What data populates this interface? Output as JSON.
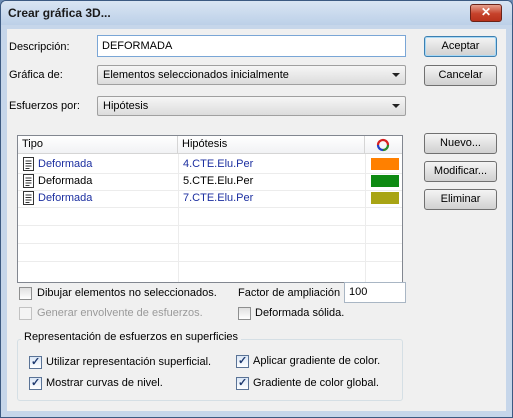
{
  "window": {
    "title": "Crear gráfica 3D...",
    "close_glyph": "✕"
  },
  "form": {
    "descripcion_label": "Descripción:",
    "descripcion_value": "DEFORMADA",
    "grafica_label": "Gráfica de:",
    "grafica_value": "Elementos seleccionados inicialmente",
    "esfuerzos_label": "Esfuerzos por:",
    "esfuerzos_value": "Hipótesis"
  },
  "buttons": {
    "aceptar": "Aceptar",
    "cancelar": "Cancelar",
    "nuevo": "Nuevo...",
    "modificar": "Modificar...",
    "eliminar": "Eliminar"
  },
  "table": {
    "headers": {
      "tipo": "Tipo",
      "hipotesis": "Hipótesis",
      "color_icon": "color-wheel-icon"
    },
    "rows": [
      {
        "tipo": "Deformada",
        "hipotesis": "4.CTE.Elu.Per",
        "color": "#ff8000",
        "highlight": true
      },
      {
        "tipo": "Deformada",
        "hipotesis": "5.CTE.Elu.Per",
        "color": "#0e8a12",
        "highlight": false
      },
      {
        "tipo": "Deformada",
        "hipotesis": "7.CTE.Elu.Per",
        "color": "#a8a414",
        "highlight": true
      }
    ]
  },
  "options": {
    "dibujar_label": "Dibujar elementos no seleccionados.",
    "dibujar_checked": false,
    "envolvente_label": "Generar envolvente de esfuerzos.",
    "envolvente_enabled": false,
    "factor_label": "Factor de ampliación",
    "factor_value": "100",
    "deformada_solida_label": "Deformada sólida.",
    "deformada_solida_checked": false
  },
  "group": {
    "title": "Representación de esfuerzos en superficies",
    "utilizar_label": "Utilizar representación superficial.",
    "utilizar_checked": true,
    "mostrar_label": "Mostrar curvas de nivel.",
    "mostrar_checked": true,
    "aplicar_label": "Aplicar gradiente de color.",
    "aplicar_checked": true,
    "gradiente_label": "Gradiente de color global.",
    "gradiente_checked": true
  },
  "colors": {
    "accent": "#3c7fb1",
    "link_text": "#1c2fa0"
  }
}
